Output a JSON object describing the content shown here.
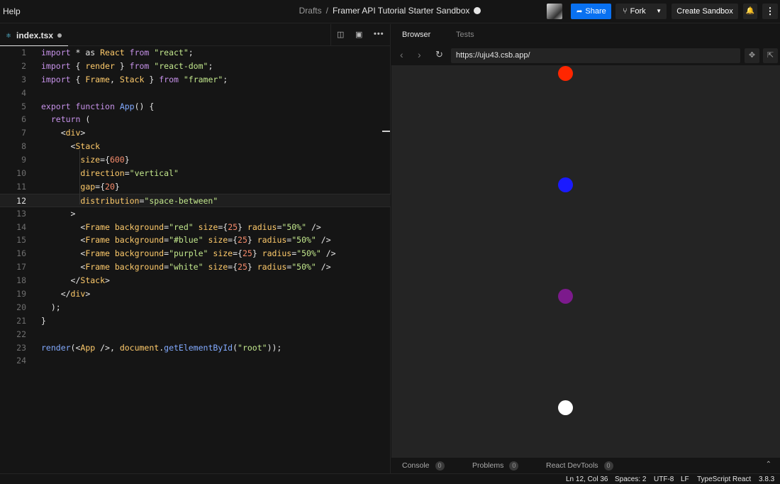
{
  "topbar": {
    "help": "Help",
    "breadcrumb": {
      "folder": "Drafts",
      "separator": "/",
      "title": "Framer API Tutorial Starter Sandbox"
    },
    "share_label": "Share",
    "fork_label": "Fork",
    "create_label": "Create Sandbox"
  },
  "editor": {
    "tab": {
      "filename": "index.tsx",
      "unsaved": true
    },
    "active_line": 12,
    "lines": [
      [
        [
          "kw",
          "import"
        ],
        [
          "pun",
          " * as "
        ],
        [
          "tag",
          "React"
        ],
        [
          "pun",
          " "
        ],
        [
          "kw",
          "from"
        ],
        [
          "pun",
          " "
        ],
        [
          "str",
          "\"react\""
        ],
        [
          "pun",
          ";"
        ]
      ],
      [
        [
          "kw",
          "import"
        ],
        [
          "pun",
          " { "
        ],
        [
          "tag",
          "render"
        ],
        [
          "pun",
          " } "
        ],
        [
          "kw",
          "from"
        ],
        [
          "pun",
          " "
        ],
        [
          "str",
          "\"react-dom\""
        ],
        [
          "pun",
          ";"
        ]
      ],
      [
        [
          "kw",
          "import"
        ],
        [
          "pun",
          " { "
        ],
        [
          "tag",
          "Frame"
        ],
        [
          "pun",
          ", "
        ],
        [
          "tag",
          "Stack"
        ],
        [
          "pun",
          " } "
        ],
        [
          "kw",
          "from"
        ],
        [
          "pun",
          " "
        ],
        [
          "str",
          "\"framer\""
        ],
        [
          "pun",
          ";"
        ]
      ],
      [],
      [
        [
          "kw",
          "export"
        ],
        [
          "pun",
          " "
        ],
        [
          "kw",
          "function"
        ],
        [
          "pun",
          " "
        ],
        [
          "fn",
          "App"
        ],
        [
          "pun",
          "() {"
        ]
      ],
      [
        [
          "pun",
          "  "
        ],
        [
          "kw",
          "return"
        ],
        [
          "pun",
          " ("
        ]
      ],
      [
        [
          "pun",
          "    <"
        ],
        [
          "tag",
          "div"
        ],
        [
          "pun",
          ">"
        ]
      ],
      [
        [
          "pun",
          "      <"
        ],
        [
          "tag",
          "Stack"
        ]
      ],
      [
        [
          "pun",
          "        "
        ],
        [
          "attr",
          "size"
        ],
        [
          "pun",
          "={"
        ],
        [
          "num",
          "600"
        ],
        [
          "pun",
          "}"
        ]
      ],
      [
        [
          "pun",
          "        "
        ],
        [
          "attr",
          "direction"
        ],
        [
          "pun",
          "="
        ],
        [
          "str",
          "\"vertical\""
        ]
      ],
      [
        [
          "pun",
          "        "
        ],
        [
          "attr",
          "gap"
        ],
        [
          "pun",
          "={"
        ],
        [
          "num",
          "20"
        ],
        [
          "pun",
          "}"
        ]
      ],
      [
        [
          "pun",
          "        "
        ],
        [
          "attr",
          "distribution"
        ],
        [
          "pun",
          "="
        ],
        [
          "str",
          "\"space-between\""
        ]
      ],
      [
        [
          "pun",
          "      >"
        ]
      ],
      [
        [
          "pun",
          "        <"
        ],
        [
          "tag",
          "Frame"
        ],
        [
          "pun",
          " "
        ],
        [
          "attr",
          "background"
        ],
        [
          "pun",
          "="
        ],
        [
          "str",
          "\"red\""
        ],
        [
          "pun",
          " "
        ],
        [
          "attr",
          "size"
        ],
        [
          "pun",
          "={"
        ],
        [
          "num",
          "25"
        ],
        [
          "pun",
          "} "
        ],
        [
          "attr",
          "radius"
        ],
        [
          "pun",
          "="
        ],
        [
          "str",
          "\"50%\""
        ],
        [
          "pun",
          " />"
        ]
      ],
      [
        [
          "pun",
          "        <"
        ],
        [
          "tag",
          "Frame"
        ],
        [
          "pun",
          " "
        ],
        [
          "attr",
          "background"
        ],
        [
          "pun",
          "="
        ],
        [
          "str",
          "\"#blue\""
        ],
        [
          "pun",
          " "
        ],
        [
          "attr",
          "size"
        ],
        [
          "pun",
          "={"
        ],
        [
          "num",
          "25"
        ],
        [
          "pun",
          "} "
        ],
        [
          "attr",
          "radius"
        ],
        [
          "pun",
          "="
        ],
        [
          "str",
          "\"50%\""
        ],
        [
          "pun",
          " />"
        ]
      ],
      [
        [
          "pun",
          "        <"
        ],
        [
          "tag",
          "Frame"
        ],
        [
          "pun",
          " "
        ],
        [
          "attr",
          "background"
        ],
        [
          "pun",
          "="
        ],
        [
          "str",
          "\"purple\""
        ],
        [
          "pun",
          " "
        ],
        [
          "attr",
          "size"
        ],
        [
          "pun",
          "={"
        ],
        [
          "num",
          "25"
        ],
        [
          "pun",
          "} "
        ],
        [
          "attr",
          "radius"
        ],
        [
          "pun",
          "="
        ],
        [
          "str",
          "\"50%\""
        ],
        [
          "pun",
          " />"
        ]
      ],
      [
        [
          "pun",
          "        <"
        ],
        [
          "tag",
          "Frame"
        ],
        [
          "pun",
          " "
        ],
        [
          "attr",
          "background"
        ],
        [
          "pun",
          "="
        ],
        [
          "str",
          "\"white\""
        ],
        [
          "pun",
          " "
        ],
        [
          "attr",
          "size"
        ],
        [
          "pun",
          "={"
        ],
        [
          "num",
          "25"
        ],
        [
          "pun",
          "} "
        ],
        [
          "attr",
          "radius"
        ],
        [
          "pun",
          "="
        ],
        [
          "str",
          "\"50%\""
        ],
        [
          "pun",
          " />"
        ]
      ],
      [
        [
          "pun",
          "      </"
        ],
        [
          "tag",
          "Stack"
        ],
        [
          "pun",
          ">"
        ]
      ],
      [
        [
          "pun",
          "    </"
        ],
        [
          "tag",
          "div"
        ],
        [
          "pun",
          ">"
        ]
      ],
      [
        [
          "pun",
          "  );"
        ]
      ],
      [
        [
          "pun",
          "}"
        ]
      ],
      [],
      [
        [
          "fn",
          "render"
        ],
        [
          "pun",
          "(<"
        ],
        [
          "tag",
          "App"
        ],
        [
          "pun",
          " />, "
        ],
        [
          "tag",
          "document"
        ],
        [
          "pun",
          "."
        ],
        [
          "fn",
          "getElementById"
        ],
        [
          "pun",
          "("
        ],
        [
          "str",
          "\"root\""
        ],
        [
          "pun",
          "));"
        ]
      ],
      []
    ]
  },
  "browser": {
    "tabs": [
      "Browser",
      "Tests"
    ],
    "url": "https://uju43.csb.app/",
    "circles": [
      {
        "color": "#ff2600"
      },
      {
        "color": "#1a1aff"
      },
      {
        "color": "#7c1a8c"
      },
      {
        "color": "#ffffff"
      }
    ],
    "footer": {
      "console": "Console",
      "console_count": "0",
      "problems": "Problems",
      "problems_count": "0",
      "devtools": "React DevTools",
      "devtools_count": "0"
    }
  },
  "status": {
    "position": "Ln 12, Col 36",
    "spaces": "Spaces: 2",
    "encoding": "UTF-8",
    "eol": "LF",
    "language": "TypeScript React",
    "version": "3.8.3"
  }
}
